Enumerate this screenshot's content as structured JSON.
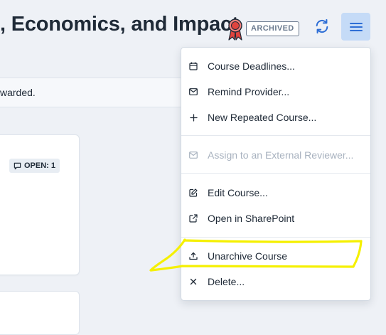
{
  "header": {
    "title": ", Economics, and Impact",
    "status_badge": "ARCHIVED",
    "icons": {
      "ribbon": "award-ribbon-icon",
      "refresh": "refresh-icon",
      "menu": "hamburger-menu-icon"
    }
  },
  "notice": {
    "text": "warded."
  },
  "card": {
    "open_badge": "OPEN: 1",
    "open_icon": "comment-icon"
  },
  "menu": {
    "items": [
      {
        "label": "Course Deadlines...",
        "icon": "calendar-icon",
        "enabled": true
      },
      {
        "label": "Remind Provider...",
        "icon": "envelope-icon",
        "enabled": true
      },
      {
        "label": "New Repeated Course...",
        "icon": "plus-icon",
        "enabled": true
      },
      {
        "label": "Assign to an External Reviewer...",
        "icon": "envelope-icon",
        "enabled": false
      },
      {
        "label": "Edit Course...",
        "icon": "edit-icon",
        "enabled": true
      },
      {
        "label": "Open in SharePoint",
        "icon": "external-link-icon",
        "enabled": true
      },
      {
        "label": "Unarchive Course",
        "icon": "upload-icon",
        "enabled": true
      },
      {
        "label": "Delete...",
        "icon": "close-icon",
        "enabled": true
      }
    ]
  },
  "colors": {
    "background": "#eef1f6",
    "accent": "#2f6fd6",
    "menu_button_bg": "#c5dbf7",
    "badge_gray": "#6b7a8f",
    "disabled_text": "#a8b2bf",
    "ribbon_red": "#e0443e",
    "highlight_yellow": "#f5f000"
  }
}
